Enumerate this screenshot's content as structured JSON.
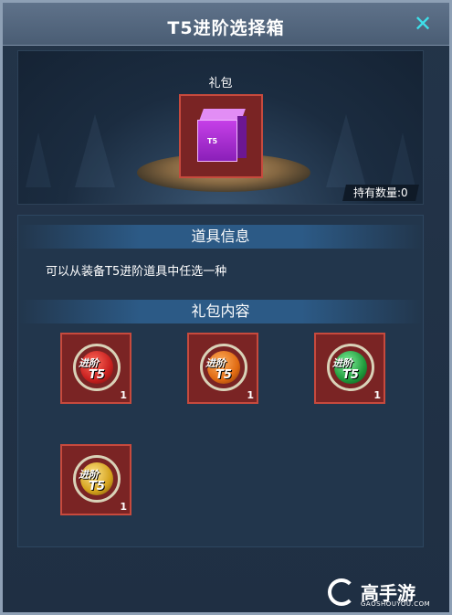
{
  "window": {
    "title": "T5进阶选择箱",
    "close_glyph": "✕"
  },
  "gift": {
    "label": "礼包",
    "box_tag": "T5",
    "count_label": "持有数量:0",
    "icon": "purple-cube-icon"
  },
  "info": {
    "header": "道具信息",
    "description": "可以从装备T5进阶道具中任选一种"
  },
  "contents": {
    "header": "礼包内容",
    "items": [
      {
        "line1": "进阶",
        "line2": "T5",
        "qty": "1",
        "color": "#c8201f",
        "icon": "red-coin-icon"
      },
      {
        "line1": "进阶",
        "line2": "T5",
        "qty": "1",
        "color": "#e06a12",
        "icon": "orange-coin-icon"
      },
      {
        "line1": "进阶",
        "line2": "T5",
        "qty": "1",
        "color": "#1f9a3b",
        "icon": "green-coin-icon"
      },
      {
        "line1": "进阶",
        "line2": "T5",
        "qty": "1",
        "color": "#d4a21c",
        "icon": "gold-coin-icon"
      }
    ]
  },
  "watermark": {
    "brand": "高手游",
    "site": "GAOSHOUYOU.COM"
  }
}
